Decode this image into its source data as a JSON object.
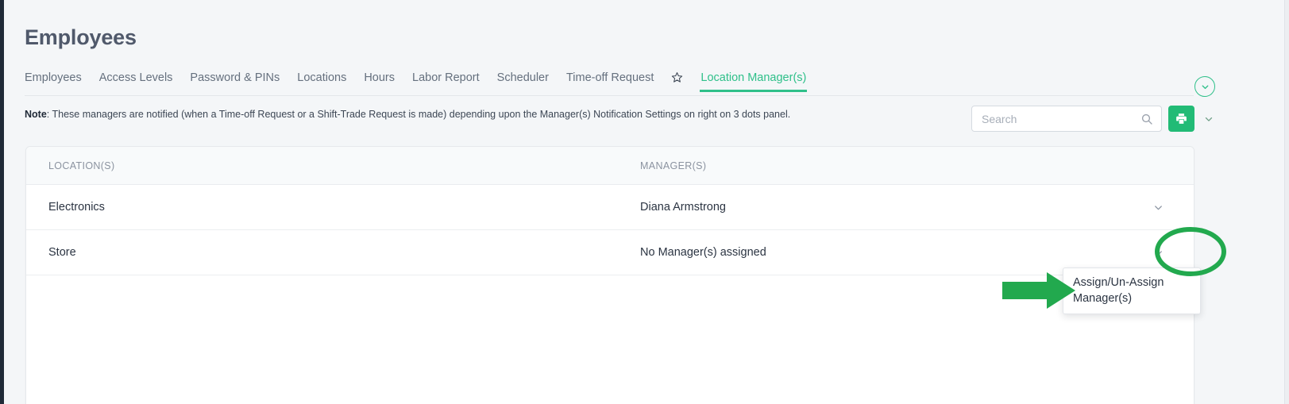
{
  "page": {
    "title": "Employees"
  },
  "tabs": [
    {
      "label": "Employees",
      "active": false,
      "star": false
    },
    {
      "label": "Access Levels",
      "active": false,
      "star": false
    },
    {
      "label": "Password & PINs",
      "active": false,
      "star": false
    },
    {
      "label": "Locations",
      "active": false,
      "star": false
    },
    {
      "label": "Hours",
      "active": false,
      "star": false
    },
    {
      "label": "Labor Report",
      "active": false,
      "star": false
    },
    {
      "label": "Scheduler",
      "active": false,
      "star": false
    },
    {
      "label": "Time-off Request",
      "active": false,
      "star": false
    },
    {
      "label": "Location Manager(s)",
      "active": true,
      "star": true
    }
  ],
  "note": {
    "prefix": "Note",
    "text": ": These managers are notified (when a Time-off Request or a Shift-Trade Request is made) depending upon the Manager(s) Notification Settings on right on 3 dots panel."
  },
  "search": {
    "value": "",
    "placeholder": "Search"
  },
  "toolbar": {
    "print_title": "Print",
    "caret_title": "More options",
    "expand_title": "Expand"
  },
  "table": {
    "columns": [
      "LOCATION(S)",
      "MANAGER(S)"
    ],
    "rows": [
      {
        "location": "Electronics",
        "manager": "Diana Armstrong"
      },
      {
        "location": "Store",
        "manager": "No Manager(s) assigned"
      }
    ]
  },
  "dropdown": {
    "items": [
      "Assign/Un-Assign Manager(s)"
    ]
  },
  "colors": {
    "accent_green": "#2fc08a",
    "button_green": "#22bb76",
    "annotation_green": "#22a94e",
    "title_gray": "#50596b",
    "tab_gray": "#65707e",
    "header_gray": "#8b93a0",
    "rail_dark": "#1f2a37",
    "page_bg": "#f4f6f8"
  },
  "icons": {
    "star": "star-icon",
    "search": "search-icon",
    "print": "print-icon",
    "chevron_down": "chevron-down-icon",
    "arrow_right": "arrow-right-annotation"
  }
}
